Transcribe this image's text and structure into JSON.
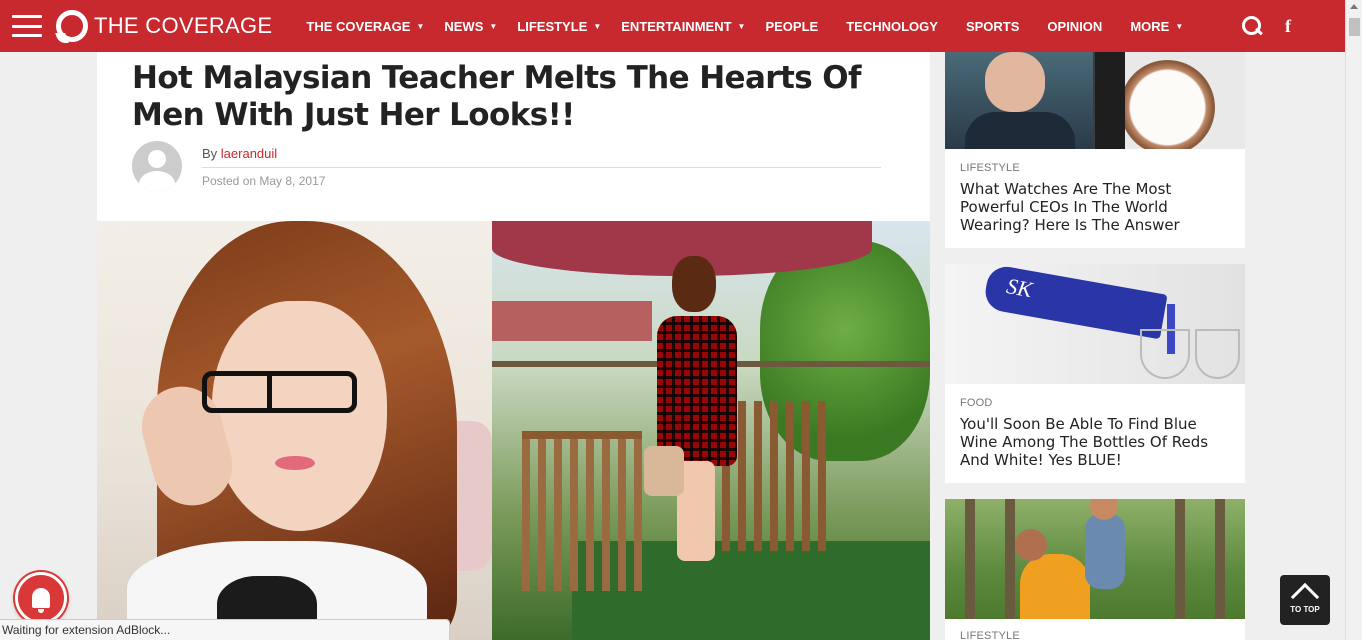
{
  "header": {
    "logo_text": "THE COVERAGE",
    "nav": [
      {
        "label": "THE COVERAGE",
        "dropdown": true
      },
      {
        "label": "NEWS",
        "dropdown": true
      },
      {
        "label": "LIFESTYLE",
        "dropdown": true
      },
      {
        "label": "ENTERTAINMENT",
        "dropdown": true
      },
      {
        "label": "PEOPLE",
        "dropdown": false
      },
      {
        "label": "TECHNOLOGY",
        "dropdown": false
      },
      {
        "label": "SPORTS",
        "dropdown": false
      },
      {
        "label": "OPINION",
        "dropdown": false
      },
      {
        "label": "MORE",
        "dropdown": true
      }
    ],
    "facebook_glyph": "f",
    "brand_color": "#c8292f"
  },
  "article": {
    "title": "Hot Malaysian Teacher Melts The Hearts Of Men With Just Her Looks!!",
    "by_prefix": "By",
    "author": "laeranduil",
    "posted": "Posted on May 8, 2017"
  },
  "sidebar": {
    "cards": [
      {
        "category": "LIFESTYLE",
        "title": "What Watches Are The Most Powerful CEOs In The World Wearing? Here Is The Answer"
      },
      {
        "category": "FOOD",
        "title": "You'll Soon Be Able To Find Blue Wine Among The Bottles Of Reds And White! Yes BLUE!"
      },
      {
        "category": "LIFESTYLE",
        "title": ""
      }
    ]
  },
  "status_text": "Waiting for extension AdBlock...",
  "to_top_label": "TO TOP"
}
